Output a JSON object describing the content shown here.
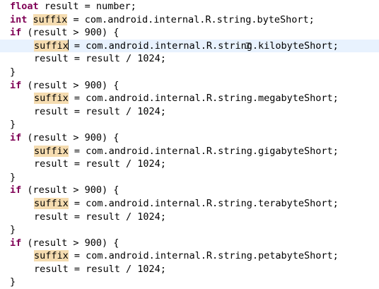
{
  "editor": {
    "lines": [
      {
        "segments": [
          {
            "text": "float",
            "kind": "keyword"
          },
          {
            "text": " result = number;",
            "kind": "plain"
          }
        ]
      },
      {
        "segments": [
          {
            "text": "int",
            "kind": "keyword"
          },
          {
            "text": " ",
            "kind": "plain"
          },
          {
            "text": "suffix",
            "kind": "occurrence"
          },
          {
            "text": " = com.android.internal.R.string.byteShort;",
            "kind": "plain"
          }
        ]
      },
      {
        "segments": [
          {
            "text": "if",
            "kind": "keyword"
          },
          {
            "text": " (result > 900) {",
            "kind": "plain"
          }
        ]
      },
      {
        "current": true,
        "segments": [
          {
            "text": "suffix",
            "kind": "occurrence"
          },
          {
            "text": " = com.android.internal.R.string.kilobyteShort;",
            "kind": "plain"
          }
        ]
      },
      {
        "segments": [
          {
            "text": "result = result / 1024;",
            "kind": "plain"
          }
        ]
      },
      {
        "segments": [
          {
            "text": "}",
            "kind": "plain"
          }
        ]
      },
      {
        "segments": [
          {
            "text": "if",
            "kind": "keyword"
          },
          {
            "text": " (result > 900) {",
            "kind": "plain"
          }
        ]
      },
      {
        "segments": [
          {
            "text": "suffix",
            "kind": "occurrence"
          },
          {
            "text": " = com.android.internal.R.string.megabyteShort;",
            "kind": "plain"
          }
        ]
      },
      {
        "segments": [
          {
            "text": "result = result / 1024;",
            "kind": "plain"
          }
        ]
      },
      {
        "segments": [
          {
            "text": "}",
            "kind": "plain"
          }
        ]
      },
      {
        "segments": [
          {
            "text": "if",
            "kind": "keyword"
          },
          {
            "text": " (result > 900) {",
            "kind": "plain"
          }
        ]
      },
      {
        "segments": [
          {
            "text": "suffix",
            "kind": "occurrence"
          },
          {
            "text": " = com.android.internal.R.string.gigabyteShort;",
            "kind": "plain"
          }
        ]
      },
      {
        "segments": [
          {
            "text": "result = result / 1024;",
            "kind": "plain"
          }
        ]
      },
      {
        "segments": [
          {
            "text": "}",
            "kind": "plain"
          }
        ]
      },
      {
        "segments": [
          {
            "text": "if",
            "kind": "keyword"
          },
          {
            "text": " (result > 900) {",
            "kind": "plain"
          }
        ]
      },
      {
        "segments": [
          {
            "text": "suffix",
            "kind": "occurrence"
          },
          {
            "text": " = com.android.internal.R.string.terabyteShort;",
            "kind": "plain"
          }
        ]
      },
      {
        "segments": [
          {
            "text": "result = result / 1024;",
            "kind": "plain"
          }
        ]
      },
      {
        "segments": [
          {
            "text": "}",
            "kind": "plain"
          }
        ]
      },
      {
        "segments": [
          {
            "text": "if",
            "kind": "keyword"
          },
          {
            "text": " (result > 900) {",
            "kind": "plain"
          }
        ]
      },
      {
        "segments": [
          {
            "text": "suffix",
            "kind": "occurrence"
          },
          {
            "text": " = com.android.internal.R.string.petabyteShort;",
            "kind": "plain"
          }
        ]
      },
      {
        "segments": [
          {
            "text": "result = result / 1024;",
            "kind": "plain"
          }
        ]
      },
      {
        "segments": [
          {
            "text": "}",
            "kind": "plain"
          }
        ]
      }
    ]
  },
  "colors": {
    "keyword": "#7f0055",
    "occurrence_highlight": "#f5dcb0",
    "current_line": "#e8f2fe",
    "text": "#000000",
    "background": "#ffffff"
  },
  "mouse_pointer": "text-ibeam"
}
